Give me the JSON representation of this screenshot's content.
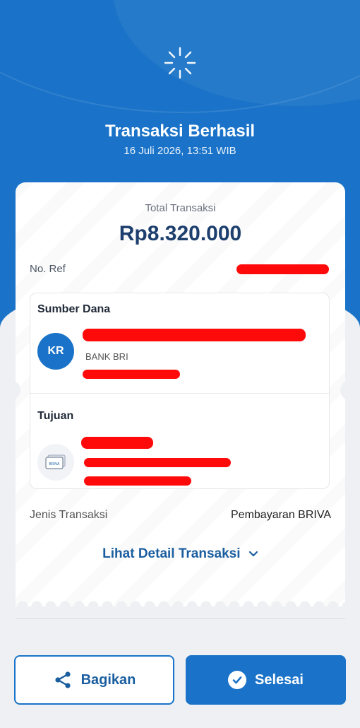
{
  "header": {
    "title": "Transaksi Berhasil",
    "datetime": "16 Juli 2026, 13:51 WIB",
    "icon": "success-sparkle-icon"
  },
  "receipt": {
    "total_label": "Total Transaksi",
    "total_amount": "Rp8.320.000",
    "ref_label": "No. Ref",
    "source": {
      "title": "Sumber Dana",
      "avatar_initials": "KR",
      "bank": "BANK BRI"
    },
    "destination": {
      "title": "Tujuan",
      "icon": "briva-card-icon",
      "card_text": "BRIVA"
    },
    "type_label": "Jenis Transaksi",
    "type_value": "Pembayaran BRIVA",
    "detail_link": "Lihat Detail Transaksi"
  },
  "actions": {
    "share_label": "Bagikan",
    "done_label": "Selesai"
  },
  "colors": {
    "primary": "#1a73c8",
    "amount": "#1d3f6e",
    "redaction": "#ff0a0a"
  }
}
